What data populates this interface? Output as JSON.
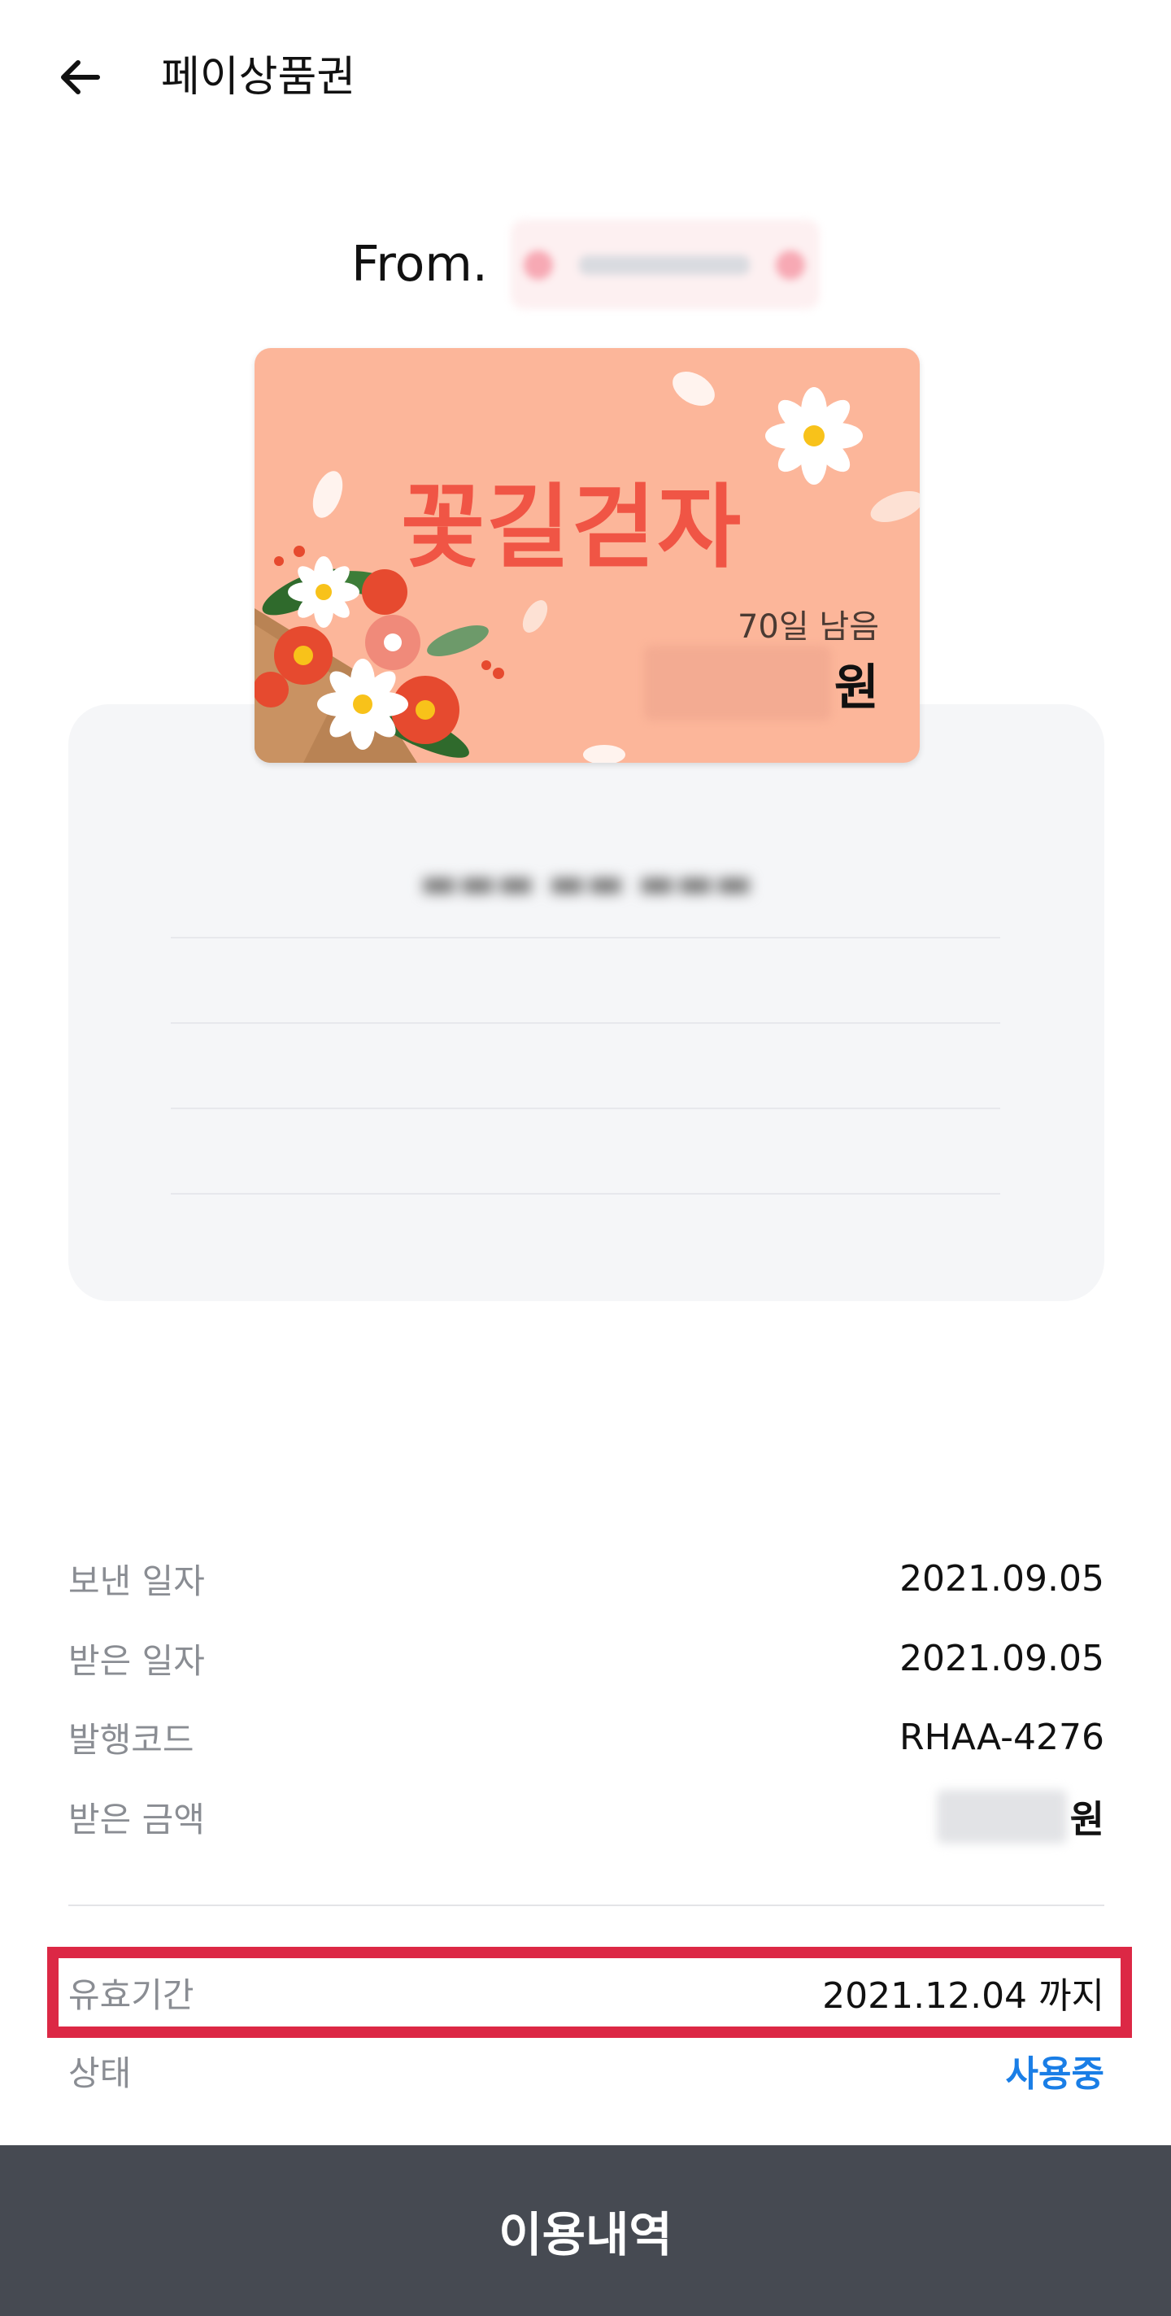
{
  "header": {
    "title": "페이상품권",
    "back_icon": "arrow-left-icon"
  },
  "gift": {
    "from_label": "From.",
    "card_title": "꽃길걷자",
    "remaining": "70일 남음",
    "currency": "원"
  },
  "details": [
    {
      "label": "보낸 일자",
      "value": "2021.09.05"
    },
    {
      "label": "받은 일자",
      "value": "2021.09.05"
    },
    {
      "label": "발행코드",
      "value": "RHAA-4276"
    },
    {
      "label": "받은 금액",
      "value": "원"
    }
  ],
  "validity": {
    "label": "유효기간",
    "value": "2021.12.04 까지"
  },
  "status": {
    "label": "상태",
    "value": "사용중",
    "color": "#1a7ee6"
  },
  "bottom_button": {
    "label": "이용내역"
  },
  "colors": {
    "card_bg": "#fcb69a",
    "card_title": "#f05545",
    "bottom_bar": "#464a52",
    "highlight": "#dc2845"
  }
}
